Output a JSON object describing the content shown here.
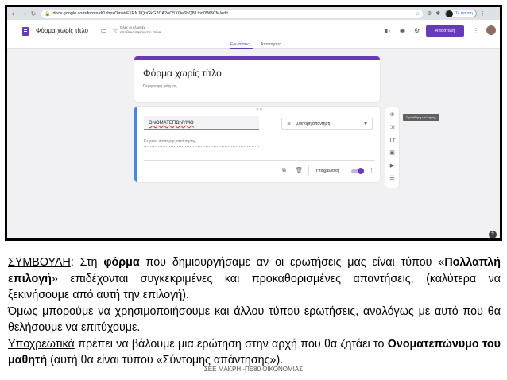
{
  "browser": {
    "url": "docs.google.com/forms/d/1xbpxOmeirF1RNJIQnGkG2CA2oC5XQe6bQ8iUhq0WBCM/edit",
    "profile_label": "Σε παύση"
  },
  "app": {
    "title": "Φόρμα χωρίς τίτλο",
    "save_note": "Όλες οι αλλαγές αποθηκεύτηκαν στο Drive",
    "send_label": "Αποστολή",
    "tabs": [
      {
        "label": "Ερωτήσεις",
        "active": true
      },
      {
        "label": "Απαντήσεις",
        "active": false
      }
    ],
    "accent_color": "#673ab7"
  },
  "form": {
    "heading": "Φόρμα χωρίς τίτλο",
    "description_placeholder": "Περιγραφή φόρμας"
  },
  "question": {
    "title": "ΟΝΟΜΑΤΕΠΩΝΥΜΟ",
    "type": "Σύντομη απάντηση",
    "answer_placeholder": "Κείμενο σύντομης απάντησης",
    "required_label": "Υποχρεωτική",
    "required": true
  },
  "side_toolbar": {
    "tooltip": "Προσθήκη ερώτησης",
    "icons": [
      "add-question-icon",
      "import-question-icon",
      "add-title-icon",
      "add-image-icon",
      "add-video-icon",
      "add-section-icon"
    ]
  },
  "instructions": {
    "tip_label": "ΣΥΜΒΟΥΛΗ",
    "p1_a": ": Στη ",
    "p1_form": "φόρμα",
    "p1_b": " που δημιουργήσαμε αν οι ερωτήσεις μας είναι τύπου «",
    "p1_multi": "Πολλαπλή επιλογή",
    "p1_c": "» επιδέχονται συγκεκριμένες και προκαθορισμένες απαντήσεις, (καλύτερα να ξεκινήσουμε από αυτή την επιλογή).",
    "p2": "Όμως μπορούμε να χρησιμοποιήσουμε και άλλου τύπου ερωτήσεις, αναλόγως με αυτό που θα θελήσουμε να επιτύχουμε.",
    "p3_req": "Υποχρεωτικά",
    "p3_a": " πρέπει να βάλουμε μια ερώτηση στην αρχή που θα ζητάει το ",
    "p3_name": "Ονοματεπώνυμο του μαθητή",
    "p3_b": " (αυτή θα είναι τύπου «Σύντομης απάντησης»)."
  },
  "footer": "ΣΕΕ ΜΑΚΡΗ -ΠΕ80 ΟΙΚΟΝΟΜΙΑΣ"
}
